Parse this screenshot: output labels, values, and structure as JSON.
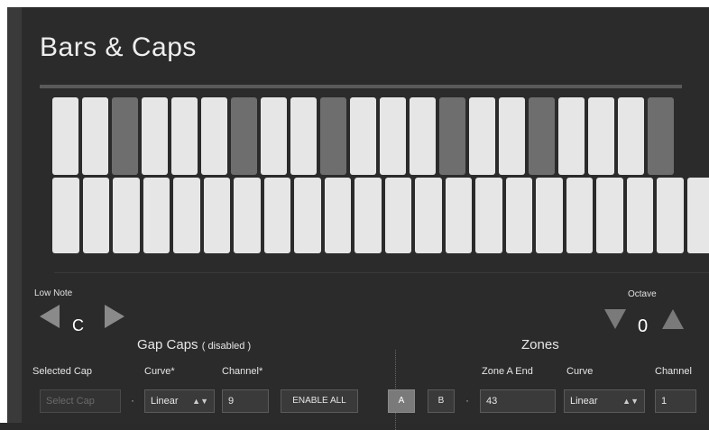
{
  "title": "Bars & Caps",
  "keyboard": {
    "row1": [
      "light",
      "light",
      "dark",
      "light",
      "light",
      "light",
      "dark",
      "light",
      "light",
      "dark",
      "light",
      "light",
      "light",
      "dark",
      "light",
      "light",
      "dark",
      "light",
      "light",
      "light",
      "dark"
    ],
    "row2_count": 22
  },
  "low_note": {
    "label": "Low Note",
    "value": "C"
  },
  "octave": {
    "label": "Octave",
    "value": "0"
  },
  "gap_caps": {
    "title": "Gap Caps",
    "status": "( disabled )",
    "selected_cap_label": "Selected Cap",
    "selected_cap_placeholder": "Select Cap",
    "curve_label": "Curve*",
    "curve_value": "Linear",
    "channel_label": "Channel*",
    "channel_value": "9",
    "enable_all_label": "ENABLE ALL"
  },
  "zones": {
    "title": "Zones",
    "zone_a_label": "A",
    "zone_b_label": "B",
    "zone_a_end_label": "Zone A End",
    "zone_a_end_value": "43",
    "curve_label": "Curve",
    "curve_value": "Linear",
    "channel_label": "Channel",
    "channel_value": "1"
  },
  "separator_dot": "·",
  "select_arrows": "▲▼"
}
